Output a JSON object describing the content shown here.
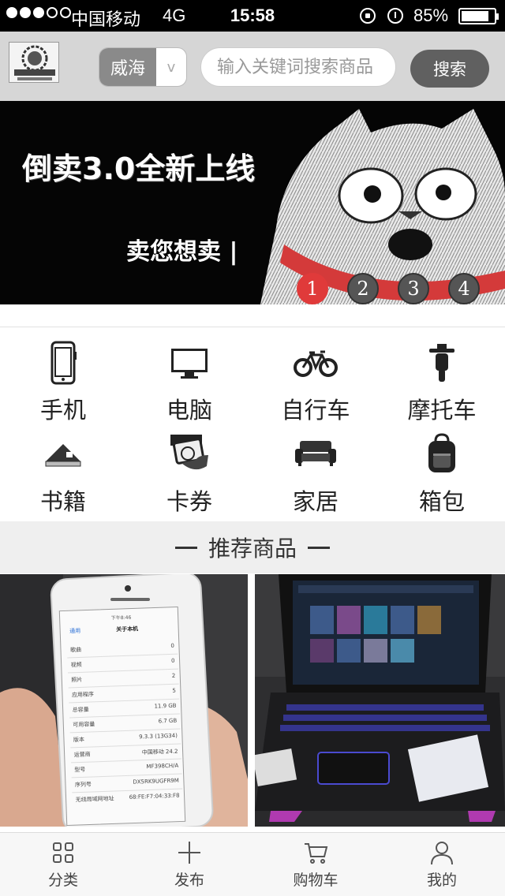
{
  "status_bar": {
    "carrier": "中国移动",
    "network": "4G",
    "time": "15:58",
    "battery_percent": "85%"
  },
  "header": {
    "city": "威海",
    "search_placeholder": "输入关键词搜索商品",
    "search_button": "搜索"
  },
  "banner": {
    "title": "倒卖3.0全新上线",
    "subtitle": "卖您想卖 |",
    "pages": [
      "1",
      "2",
      "3",
      "4"
    ],
    "active_page": 0
  },
  "categories": [
    {
      "label": "手机",
      "icon": "phone-icon"
    },
    {
      "label": "电脑",
      "icon": "monitor-icon"
    },
    {
      "label": "自行车",
      "icon": "bicycle-icon"
    },
    {
      "label": "摩托车",
      "icon": "motorcycle-icon"
    },
    {
      "label": "书籍",
      "icon": "book-icon"
    },
    {
      "label": "卡券",
      "icon": "coupon-card-icon"
    },
    {
      "label": "家居",
      "icon": "sofa-icon"
    },
    {
      "label": "箱包",
      "icon": "backpack-icon"
    }
  ],
  "recommended": {
    "title": "推荐商品",
    "phone_screen": {
      "status_time": "下午8:46",
      "back": "通用",
      "title": "关于本机",
      "rows": [
        {
          "label": "歌曲",
          "value": "0"
        },
        {
          "label": "视频",
          "value": "0"
        },
        {
          "label": "照片",
          "value": "2"
        },
        {
          "label": "应用程序",
          "value": "5"
        },
        {
          "label": "总容量",
          "value": "11.9 GB"
        },
        {
          "label": "可用容量",
          "value": "6.7 GB"
        },
        {
          "label": "版本",
          "value": "9.3.3 (13G34)"
        },
        {
          "label": "运营商",
          "value": "中国移动 24.2"
        },
        {
          "label": "型号",
          "value": "MF398CH/A"
        },
        {
          "label": "序列号",
          "value": "DX5RK9UGFR9M"
        },
        {
          "label": "无线局域网地址",
          "value": "68:FE:F7:04:33:F8"
        }
      ]
    }
  },
  "tab_bar": [
    {
      "label": "分类",
      "icon": "grid-icon"
    },
    {
      "label": "发布",
      "icon": "plus-icon"
    },
    {
      "label": "购物车",
      "icon": "cart-icon"
    },
    {
      "label": "我的",
      "icon": "user-icon"
    }
  ]
}
